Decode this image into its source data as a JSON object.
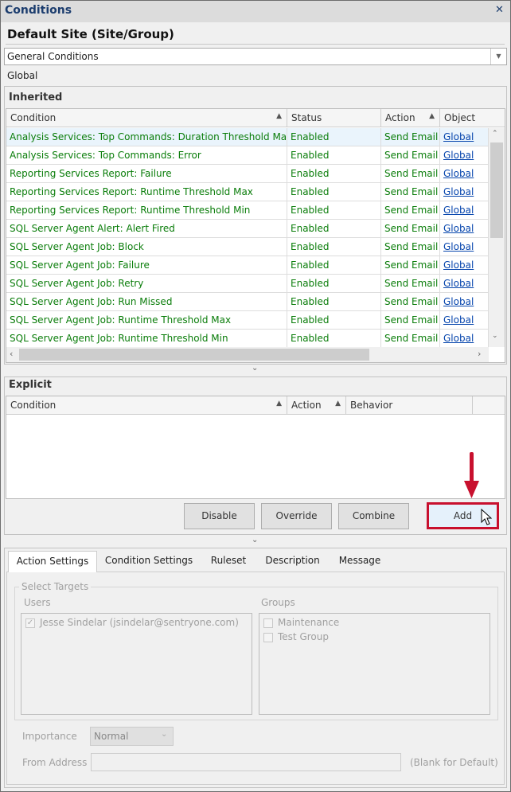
{
  "window": {
    "title": "Conditions",
    "close_icon": "close-icon"
  },
  "site_title": "Default Site (Site/Group)",
  "condition_type": {
    "value": "General Conditions"
  },
  "scope_label": "Global",
  "inherited": {
    "label": "Inherited",
    "columns": [
      "Condition",
      "Status",
      "Action",
      "Object"
    ],
    "rows": [
      {
        "condition": "Analysis Services: Top Commands: Duration Threshold Max",
        "status": "Enabled",
        "action": "Send Email",
        "object": "Global"
      },
      {
        "condition": "Analysis Services: Top Commands: Error",
        "status": "Enabled",
        "action": "Send Email",
        "object": "Global"
      },
      {
        "condition": "Reporting Services Report: Failure",
        "status": "Enabled",
        "action": "Send Email",
        "object": "Global"
      },
      {
        "condition": "Reporting Services Report: Runtime Threshold Max",
        "status": "Enabled",
        "action": "Send Email",
        "object": "Global"
      },
      {
        "condition": "Reporting Services Report: Runtime Threshold Min",
        "status": "Enabled",
        "action": "Send Email",
        "object": "Global"
      },
      {
        "condition": "SQL Server Agent Alert: Alert Fired",
        "status": "Enabled",
        "action": "Send Email",
        "object": "Global"
      },
      {
        "condition": "SQL Server Agent Job: Block",
        "status": "Enabled",
        "action": "Send Email",
        "object": "Global"
      },
      {
        "condition": "SQL Server Agent Job: Failure",
        "status": "Enabled",
        "action": "Send Email",
        "object": "Global"
      },
      {
        "condition": "SQL Server Agent Job: Retry",
        "status": "Enabled",
        "action": "Send Email",
        "object": "Global"
      },
      {
        "condition": "SQL Server Agent Job: Run Missed",
        "status": "Enabled",
        "action": "Send Email",
        "object": "Global"
      },
      {
        "condition": "SQL Server Agent Job: Runtime Threshold Max",
        "status": "Enabled",
        "action": "Send Email",
        "object": "Global"
      },
      {
        "condition": "SQL Server Agent Job: Runtime Threshold Min",
        "status": "Enabled",
        "action": "Send Email",
        "object": "Global"
      }
    ]
  },
  "explicit": {
    "label": "Explicit",
    "columns": [
      "Condition",
      "Action",
      "Behavior",
      ""
    ]
  },
  "buttons": {
    "disable": "Disable",
    "override": "Override",
    "combine": "Combine",
    "add": "Add"
  },
  "highlight_color": "#c8102e",
  "tabs": [
    "Action Settings",
    "Condition Settings",
    "Ruleset",
    "Description",
    "Message"
  ],
  "active_tab": "Action Settings",
  "targets": {
    "label": "Select Targets",
    "users_label": "Users",
    "users": [
      {
        "name": "Jesse Sindelar (jsindelar@sentryone.com)",
        "checked": true
      }
    ],
    "groups_label": "Groups",
    "groups": [
      {
        "name": "Maintenance",
        "checked": false
      },
      {
        "name": "Test Group",
        "checked": false
      }
    ]
  },
  "importance": {
    "label": "Importance",
    "value": "Normal"
  },
  "from_address": {
    "label": "From Address",
    "value": "",
    "hint": "(Blank for Default)"
  }
}
